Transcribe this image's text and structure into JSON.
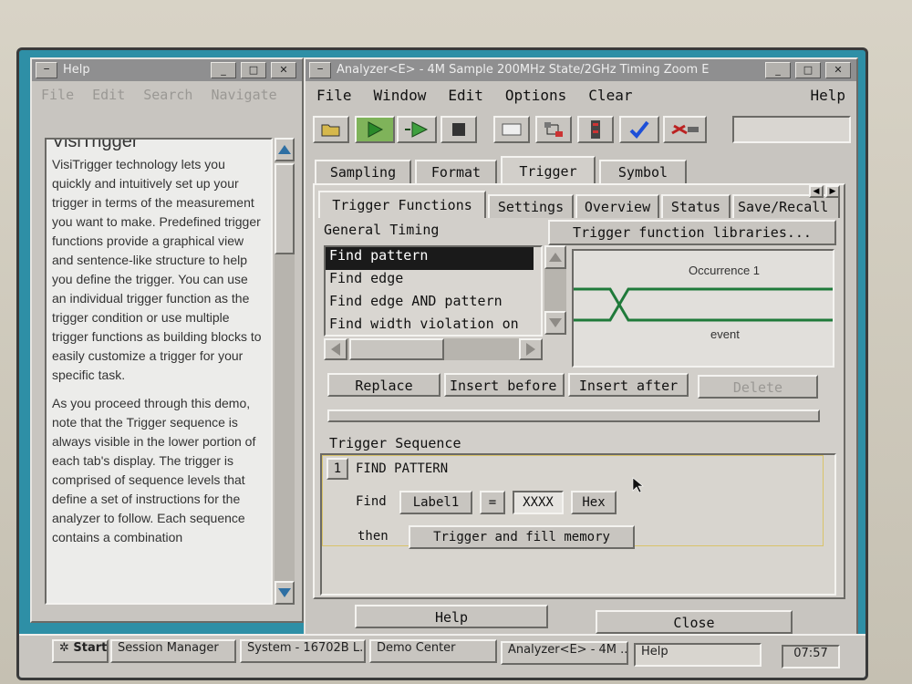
{
  "help_window": {
    "title": "Help",
    "menu_icon": "−",
    "controls": [
      "_",
      "□",
      "✕"
    ],
    "menu": [
      "File",
      "Edit",
      "Search",
      "Navigate"
    ],
    "heading": "VisiTrigger",
    "paragraphs": [
      "VisiTrigger technology lets you quickly and intuitively set up your trigger in terms of the measurement you want to make. Predefined trigger functions provide a graphical view and sentence-like structure to help you define the trigger. You can use an individual trigger function as the trigger condition or use multiple trigger functions as building blocks to easily customize a trigger for your specific task.",
      "As you proceed through this demo, note that the Trigger sequence is always visible in the lower portion of each tab's display. The trigger is comprised of sequence levels that define a set of instructions for the analyzer to follow. Each sequence contains a combination"
    ]
  },
  "analyzer_window": {
    "title": "Analyzer<E> - 4M Sample 200MHz State/2GHz Timing Zoom E",
    "menu_icon": "−",
    "controls": [
      "_",
      "□",
      "✕"
    ],
    "menu": [
      "File",
      "Window",
      "Edit",
      "Options",
      "Clear"
    ],
    "menu_help": "Help",
    "toolbar_icons": [
      "folder-icon",
      "run-icon",
      "run-repetitive-icon",
      "stop-icon",
      "blank-icon",
      "network-icon",
      "module-icon",
      "check-icon",
      "tools-icon"
    ],
    "main_tabs": [
      "Sampling",
      "Format",
      "Trigger",
      "Symbol"
    ],
    "active_main_tab": "Trigger",
    "sub_tabs": [
      "Trigger Functions",
      "Settings",
      "Overview",
      "Status",
      "Save/Recall"
    ],
    "general_timing_label": "General Timing",
    "libraries_label": "Trigger function libraries...",
    "functions": [
      "Find pattern",
      "Find edge",
      "Find edge AND pattern",
      "Find width violation on"
    ],
    "selected_function": "Find pattern",
    "preview_top_label": "Occurrence 1",
    "preview_bottom_label": "event",
    "action_buttons": [
      "Replace",
      "Insert before",
      "Insert after",
      "Delete"
    ],
    "sequence_label": "Trigger Sequence",
    "sequence": {
      "level": "1",
      "title": "FIND PATTERN",
      "find_label": "Find",
      "label_button": "Label1",
      "operator": "=",
      "value": "XXXX",
      "base": "Hex",
      "then_label": "then",
      "action": "Trigger and fill memory"
    },
    "bottom_buttons": [
      "Help",
      "Close"
    ]
  },
  "taskbar": {
    "start": "Start",
    "items": [
      "Session Manager",
      "System - 16702B L...",
      "Demo Center",
      "Analyzer<E> - 4M ...",
      "Help"
    ],
    "clock": "07:57"
  },
  "colors": {
    "desktop": "#2e8fa6",
    "titlebar": "#8f8f90",
    "window": "#c8c5c0",
    "waveform": "#1f7a3a",
    "selection": "#1a1a1a"
  }
}
